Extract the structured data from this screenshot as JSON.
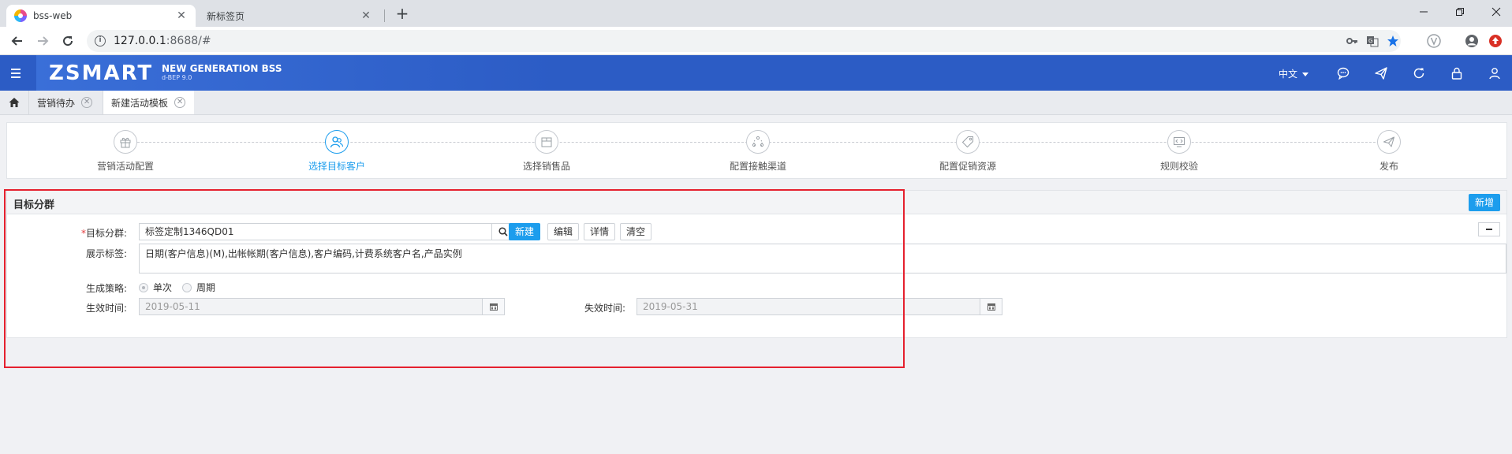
{
  "browser": {
    "tabs": [
      {
        "title": "bss-web",
        "active": true
      },
      {
        "title": "新标签页",
        "active": false
      }
    ],
    "new_tab_glyph": "+",
    "url_host": "127.0.0.1",
    "url_rest": ":8688/#",
    "window_controls": [
      "minimize-icon",
      "restore-icon",
      "close-icon"
    ]
  },
  "app": {
    "logo": "ZSMART",
    "subtitle": "NEW GENERATION BSS",
    "version": "d-BEP 9.0",
    "language": "中文",
    "header_icons": [
      "chat-icon",
      "send-icon",
      "refresh-icon",
      "lock-icon",
      "user-icon"
    ],
    "brand_color": "#2c5cc5",
    "accent_color": "#1c9ded"
  },
  "app_tabs": [
    {
      "label": "营销待办",
      "active": false
    },
    {
      "label": "新建活动模板",
      "active": true
    }
  ],
  "steps": [
    {
      "label": "营销活动配置",
      "icon": "gift-icon",
      "active": false
    },
    {
      "label": "选择目标客户",
      "icon": "users-icon",
      "active": true
    },
    {
      "label": "选择销售品",
      "icon": "box-icon",
      "active": false
    },
    {
      "label": "配置接触渠道",
      "icon": "channel-icon",
      "active": false
    },
    {
      "label": "配置促销资源",
      "icon": "tag-icon",
      "active": false
    },
    {
      "label": "规则校验",
      "icon": "code-icon",
      "active": false
    },
    {
      "label": "发布",
      "icon": "paper-plane-icon",
      "active": false
    }
  ],
  "section": {
    "title": "目标分群",
    "add_button": "新增",
    "fields": {
      "target_group": {
        "required_mark": "*",
        "label": "目标分群:",
        "value": "标签定制1346QD01",
        "buttons": {
          "new": "新建",
          "edit": "编辑",
          "detail": "详情",
          "clear": "清空"
        }
      },
      "display_tags": {
        "label": "展示标签:",
        "value": "日期(客户信息)(M),出帐帐期(客户信息),客户编码,计费系统客户名,产品实例"
      },
      "strategy": {
        "label": "生成策略:",
        "options": [
          {
            "label": "单次",
            "checked": true
          },
          {
            "label": "周期",
            "checked": false
          }
        ]
      },
      "effective_time": {
        "label": "生效时间:",
        "value": "2019-05-11"
      },
      "expire_time": {
        "label": "失效时间:",
        "value": "2019-05-31"
      }
    }
  }
}
